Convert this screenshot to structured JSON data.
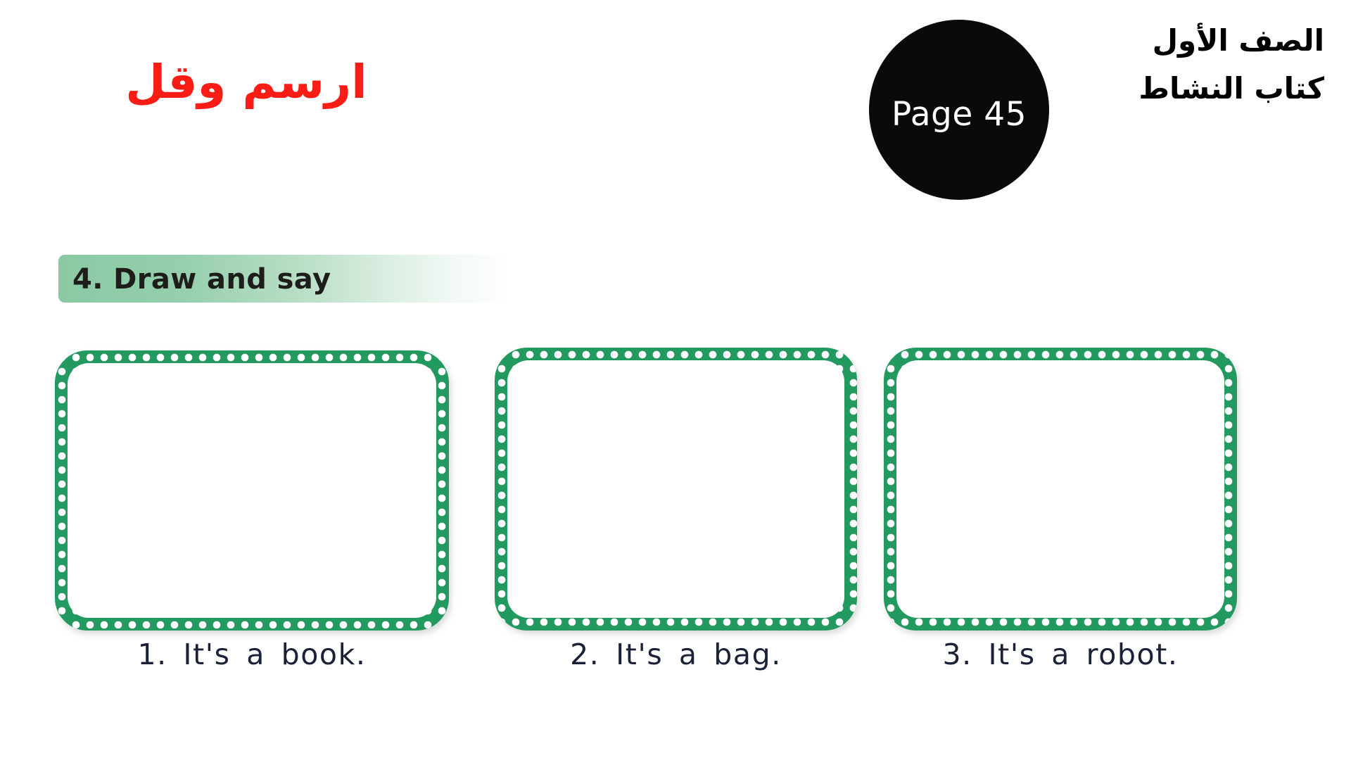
{
  "page": {
    "background_color": "#ffffff",
    "accent_green": "#22995f",
    "title_red": "#f91d16",
    "badge_black": "#0a0a0a",
    "caption_navy": "#1b2237"
  },
  "header": {
    "arabic_lines": [
      "الصف الأول",
      "كتاب النشاط"
    ],
    "grade_label": "الصف الأول",
    "book_label": "كتاب النشاط"
  },
  "page_badge": {
    "label": "Page 45",
    "page_number": "45"
  },
  "title": {
    "arabic": "ارسم وقل"
  },
  "section": {
    "number": "4.",
    "label": "4. Draw and say",
    "title_en": "Draw and say"
  },
  "activities": [
    {
      "number": "1.",
      "caption": "1.  It's  a  book.",
      "answer": "book"
    },
    {
      "number": "2.",
      "caption": "2.  It's  a  bag.",
      "answer": "bag"
    },
    {
      "number": "3.",
      "caption": "3.  It's  a  robot.",
      "answer": "robot"
    }
  ]
}
